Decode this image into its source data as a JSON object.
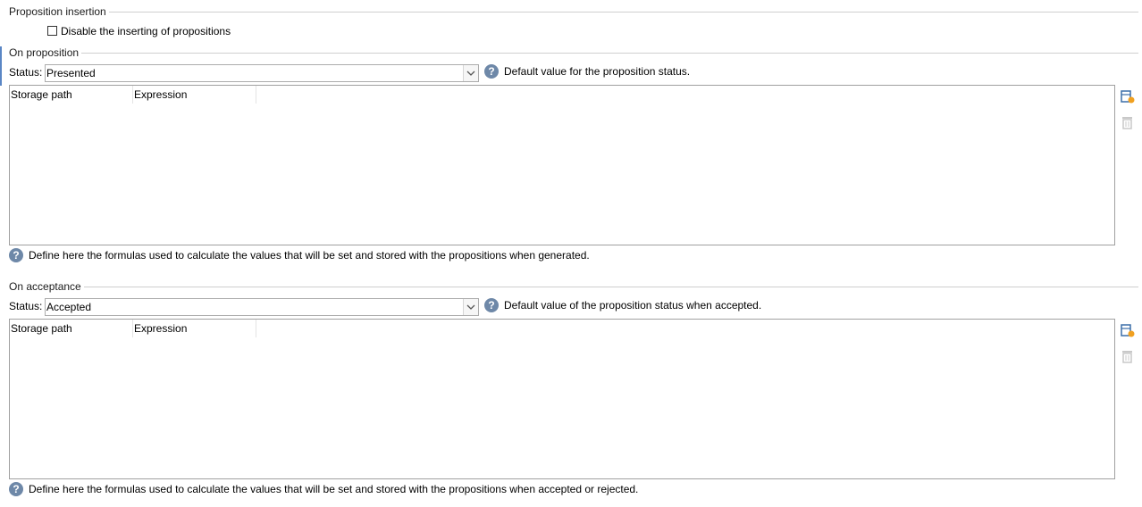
{
  "proposition_insertion": {
    "legend": "Proposition insertion",
    "disable_checkbox_label": "Disable the inserting of propositions",
    "disable_checked": false
  },
  "on_proposition": {
    "legend": "On proposition",
    "status_label": "Status:",
    "status_value": "Presented",
    "status_hint": "Default value for the proposition status.",
    "columns": [
      "Storage path",
      "Expression"
    ],
    "rows": [],
    "footer_hint": "Define here the formulas used to calculate the values that will be set and stored with the propositions when generated."
  },
  "on_acceptance": {
    "legend": "On acceptance",
    "status_label": "Status:",
    "status_value": "Accepted",
    "status_hint": "Default value of the proposition status when accepted.",
    "columns": [
      "Storage path",
      "Expression"
    ],
    "rows": [],
    "footer_hint": "Define here the formulas used to calculate the values that will be set and stored with the propositions when accepted or rejected."
  },
  "icons": {
    "help": "?",
    "add": "add-row-icon",
    "delete": "trash-icon"
  },
  "colors": {
    "help_icon": "#6e88a8",
    "accent": "#5a86c5"
  }
}
